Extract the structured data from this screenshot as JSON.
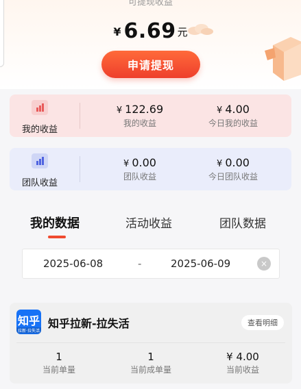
{
  "balance": {
    "caption": "可提现收益",
    "currency": "¥",
    "amount": "6.69",
    "unit": "元",
    "withdraw_label": "申请提现"
  },
  "my_income": {
    "label": "我的收益",
    "total": {
      "currency": "¥",
      "value": "122.69",
      "label": "我的收益"
    },
    "today": {
      "currency": "¥",
      "value": "4.00",
      "label": "今日我的收益"
    }
  },
  "team_income": {
    "label": "团队收益",
    "total": {
      "currency": "¥",
      "value": "0.00",
      "label": "团队收益"
    },
    "today": {
      "currency": "¥",
      "value": "0.00",
      "label": "今日团队收益"
    }
  },
  "tabs": [
    {
      "label": "我的数据",
      "active": true
    },
    {
      "label": "活动收益",
      "active": false
    },
    {
      "label": "团队数据",
      "active": false
    }
  ],
  "date_range": {
    "start": "2025-06-08",
    "separator": "-",
    "end": "2025-06-09",
    "clear_icon": "×"
  },
  "task": {
    "logo_text": "知乎",
    "logo_subtext": "拉新·拉失活",
    "title": "知乎拉新-拉失活",
    "detail_label": "查看明细",
    "stats": [
      {
        "value": "1",
        "label": "当前单量"
      },
      {
        "value": "1",
        "label": "当前成单量"
      },
      {
        "value": "¥ 4.00",
        "label": "当前收益"
      }
    ]
  },
  "colors": {
    "accent": "#ef4a2f",
    "my_income_bg": "#fbe4e4",
    "team_income_bg": "#eaedfb",
    "logo_blue": "#1772f6"
  }
}
